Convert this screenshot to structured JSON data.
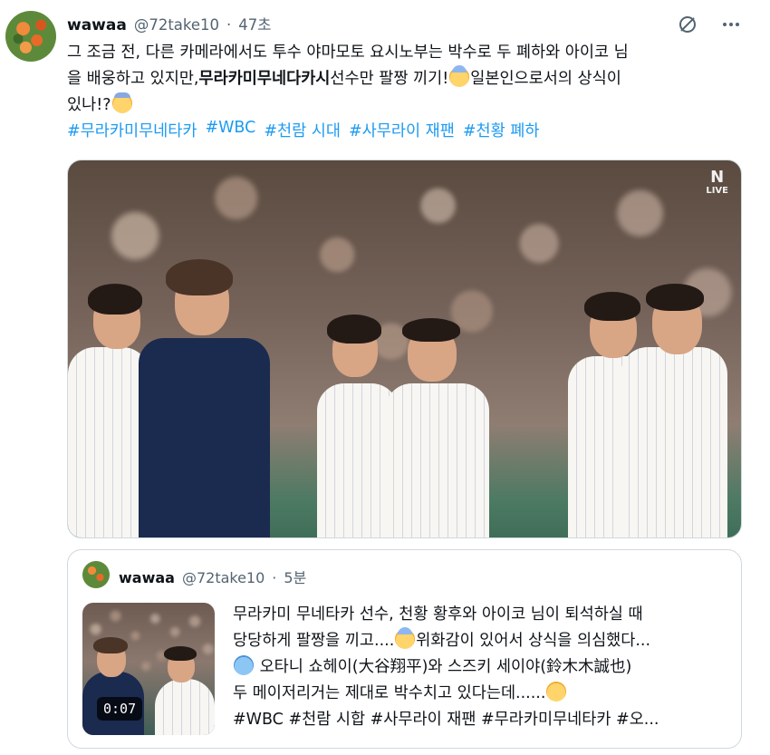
{
  "tweet": {
    "author_name": "wawaa",
    "author_handle": "@72take10",
    "separator": "·",
    "time": "47초",
    "line1": "그 조금 전, 다른 카메라에서도 투수 야마모토 요시노부는 박수로 두 폐하와 아이코 님",
    "line2_a": "을 배웅하고 있지만,",
    "line2_bold": "무라카미무네다카시",
    "line2_b": "선수만 팔짱 끼기!",
    "line2_c": "일본인으로서의 상식이",
    "line3": "있나!?",
    "hashtags": [
      "#무라카미무네타카",
      "#WBC",
      "#천람 시대",
      "#사무라이 재팬",
      "#천황 폐하"
    ]
  },
  "media": {
    "live_badge_letter": "N",
    "live_badge_text": "LIVE"
  },
  "icons": {
    "grok": "slash-circle-icon",
    "more": "more-horizontal-icon"
  },
  "quote": {
    "author_name": "wawaa",
    "author_handle": "@72take10",
    "separator": "·",
    "time": "5분",
    "duration": "0:07",
    "line1": "무라카미 무네타카 선수, 천황 황후와 아이코 님이 퇴석하실 때",
    "line2": "당당하게 팔짱을 끼고....",
    "line2_b": "위화감이 있어서 상식을 의심했다...",
    "line3": "오타니 쇼헤이(大谷翔平)와 스즈키 세이야(鈴木木誠也)",
    "line4": "두 메이저리거는 제대로 박수치고 있다는데......",
    "line5": "#WBC #천람 시합 #사무라이 재팬 #무라카미무네타카 #오..."
  }
}
